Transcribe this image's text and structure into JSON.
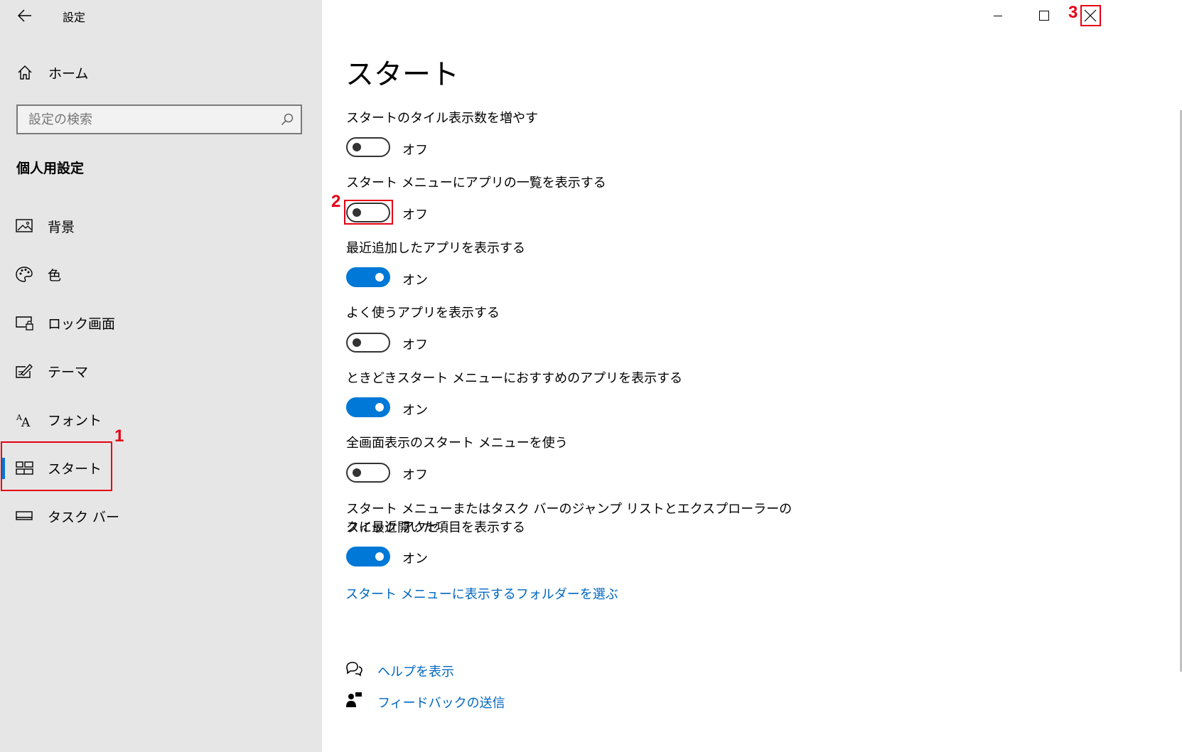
{
  "window": {
    "title": "設定",
    "minimize_icon": "minimize-icon",
    "maximize_icon": "maximize-icon",
    "close_icon": "close-icon"
  },
  "sidebar": {
    "home_label": "ホーム",
    "search_placeholder": "設定の検索",
    "search_value": "",
    "section_title": "個人用設定",
    "items": [
      {
        "label": "背景",
        "icon": "picture-icon"
      },
      {
        "label": "色",
        "icon": "palette-icon"
      },
      {
        "label": "ロック画面",
        "icon": "lock-screen-icon"
      },
      {
        "label": "テーマ",
        "icon": "theme-icon"
      },
      {
        "label": "フォント",
        "icon": "font-icon"
      },
      {
        "label": "スタート",
        "icon": "start-icon",
        "active": true
      },
      {
        "label": "タスク バー",
        "icon": "taskbar-icon"
      }
    ]
  },
  "main": {
    "title": "スタート",
    "settings": [
      {
        "label": "スタートのタイル表示数を増やす",
        "state": "オフ",
        "on": false
      },
      {
        "label": "スタート メニューにアプリの一覧を表示する",
        "state": "オフ",
        "on": false
      },
      {
        "label": "最近追加したアプリを表示する",
        "state": "オン",
        "on": true
      },
      {
        "label": "よく使うアプリを表示する",
        "state": "オフ",
        "on": false
      },
      {
        "label": "ときどきスタート メニューにおすすめのアプリを表示する",
        "state": "オン",
        "on": true
      },
      {
        "label": "全画面表示のスタート メニューを使う",
        "state": "オフ",
        "on": false
      },
      {
        "label_line1": "スタート メニューまたはタスク バーのジャンプ リストとエクスプローラーのクイック アクセ",
        "label_line2": "スに最近開いた項目を表示する",
        "state": "オン",
        "on": true
      }
    ],
    "folders_link": "スタート メニューに表示するフォルダーを選ぶ",
    "help_link": "ヘルプを表示",
    "feedback_link": "フィードバックの送信"
  },
  "annotations": [
    "1",
    "2",
    "3"
  ],
  "colors": {
    "accent": "#0078d7",
    "link": "#0067c0",
    "annotation": "#e60012",
    "sidebar_bg": "#e6e6e6"
  }
}
